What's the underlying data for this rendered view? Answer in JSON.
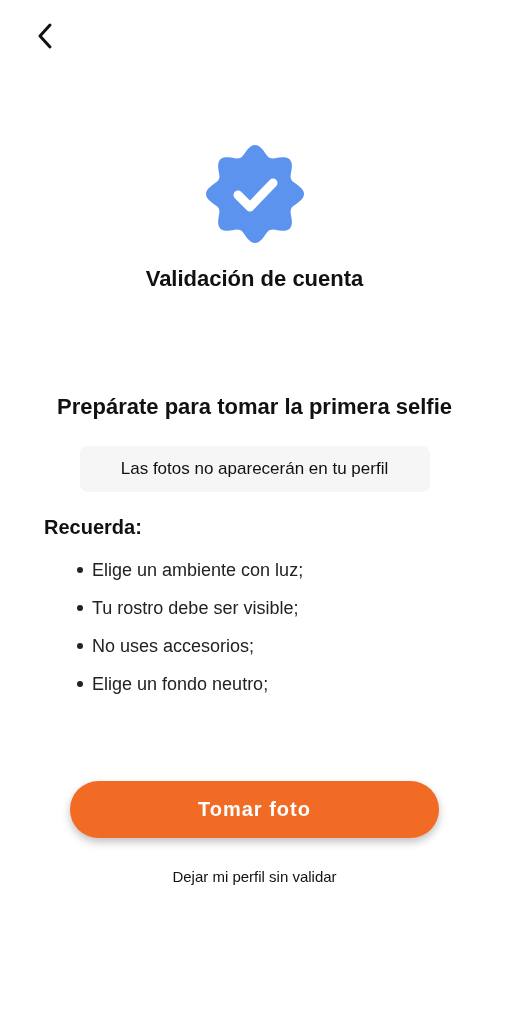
{
  "header": {
    "title": "Validación de cuenta"
  },
  "intro": {
    "heading": "Prepárate para tomar la primera selfie",
    "notice": "Las fotos no aparecerán en tu perfil"
  },
  "tips": {
    "title": "Recuerda:",
    "items": [
      "Elige un ambiente con luz;",
      "Tu rostro debe ser visible;",
      "No uses accesorios;",
      "Elige un fondo neutro;"
    ]
  },
  "actions": {
    "primary": "Tomar foto",
    "secondary": "Dejar mi perfil sin validar"
  }
}
